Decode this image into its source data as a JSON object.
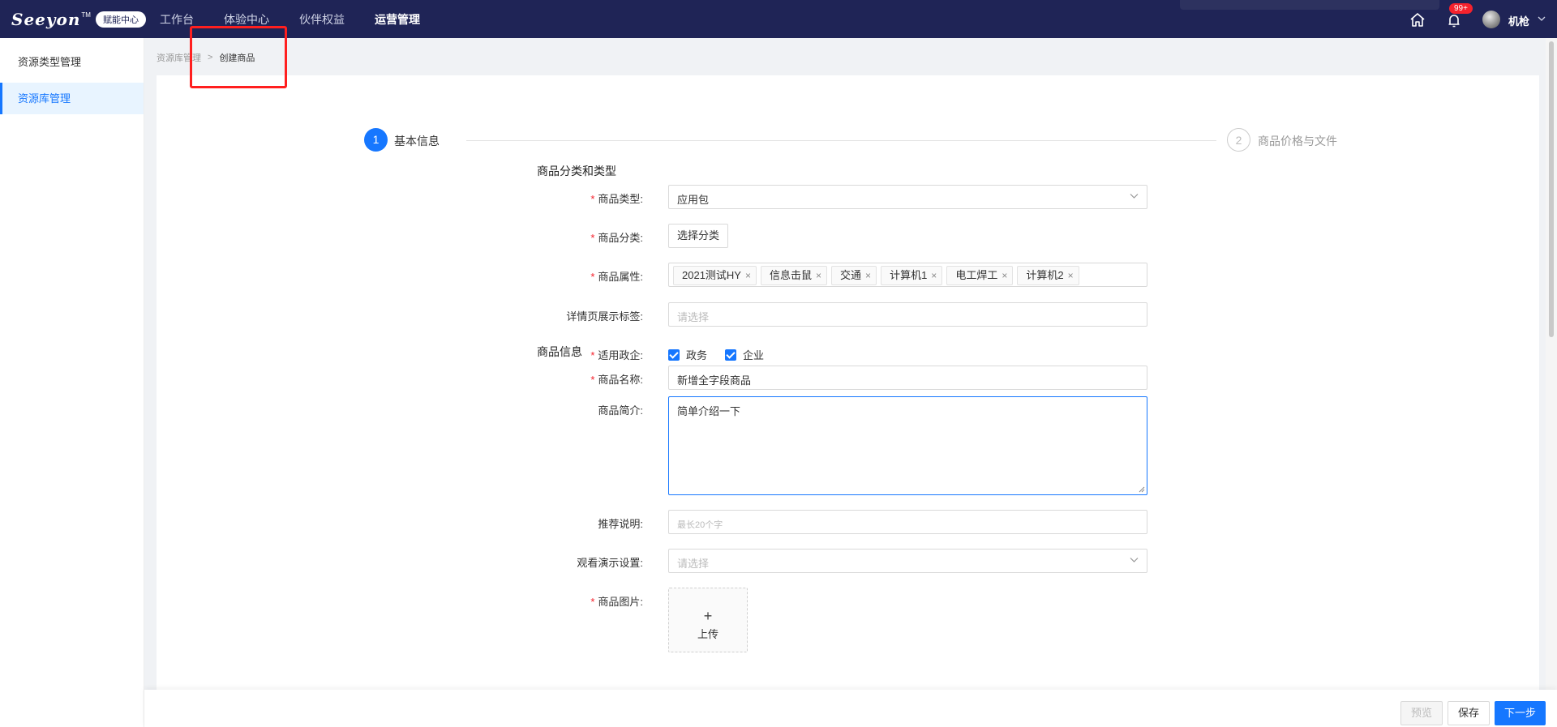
{
  "brand": {
    "logo_text": "Seeyon",
    "tm": "TM",
    "badge": "赋能中心"
  },
  "topnav": {
    "items": [
      "工作台",
      "体验中心",
      "伙伴权益",
      "运营管理"
    ],
    "active_index": 3
  },
  "header": {
    "notification_count": "99+",
    "user_name": "机枪"
  },
  "sidebar": {
    "items": [
      {
        "label": "资源类型管理"
      },
      {
        "label": "资源库管理"
      }
    ],
    "active_index": 1
  },
  "breadcrumb": {
    "items": [
      "资源库管理",
      "创建商品"
    ],
    "separator": ">"
  },
  "steps": [
    {
      "number": "1",
      "label": "基本信息",
      "status": "active"
    },
    {
      "number": "2",
      "label": "商品价格与文件",
      "status": "pending"
    }
  ],
  "form": {
    "section1_title": "商品分类和类型",
    "product_type": {
      "label": "商品类型:",
      "value": "应用包"
    },
    "category": {
      "label": "商品分类:",
      "button": "选择分类"
    },
    "attributes": {
      "label": "商品属性:",
      "tags": [
        "2021测试HY",
        "信息击鼠",
        "交通",
        "计算机1",
        "电工焊工",
        "计算机2"
      ]
    },
    "detail_tag": {
      "label": "详情页展示标签:",
      "placeholder": "请选择"
    },
    "applicable": {
      "label": "适用政企:",
      "options": [
        {
          "label": "政务",
          "checked": true
        },
        {
          "label": "企业",
          "checked": true
        }
      ]
    },
    "section2_title": "商品信息",
    "name": {
      "label": "商品名称:",
      "value": "新增全字段商品"
    },
    "intro": {
      "label": "商品简介:",
      "value": "简单介绍一下"
    },
    "recommend": {
      "label": "推荐说明:",
      "placeholder": "最长20个字"
    },
    "demo": {
      "label": "观看演示设置:",
      "placeholder": "请选择"
    },
    "image": {
      "label": "商品图片:",
      "upload_plus": "+",
      "upload_label": "上传"
    }
  },
  "footer": {
    "preview": "预览",
    "save": "保存",
    "next": "下一步"
  },
  "colors": {
    "header_bg": "#1f2456",
    "primary": "#1677ff",
    "required": "#f5222d",
    "highlight": "#ff1f1f"
  }
}
